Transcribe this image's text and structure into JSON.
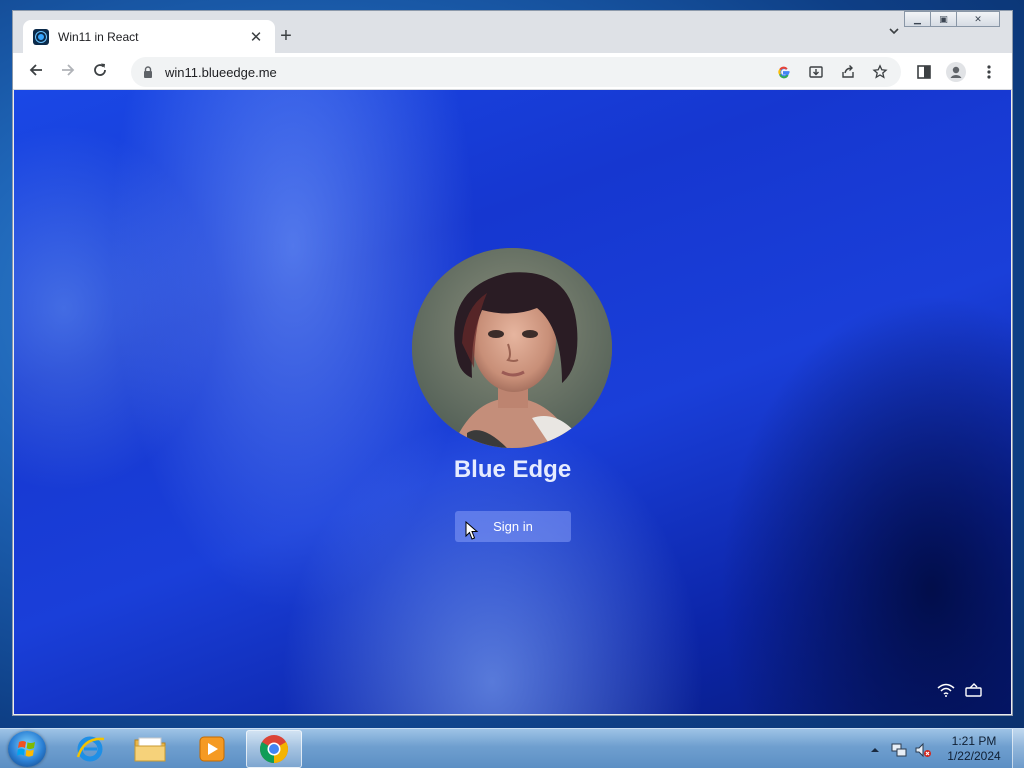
{
  "browser": {
    "tab": {
      "title": "Win11 in React",
      "favicon_icon": "win11-react-favicon",
      "close_icon": "close-icon"
    },
    "new_tab_icon": "plus-icon",
    "tab_search_icon": "chevron-down-icon",
    "window_controls": [
      "minimize-icon",
      "restore-icon",
      "close-icon"
    ],
    "toolbar": {
      "back_icon": "arrow-left-icon",
      "forward_icon": "arrow-right-icon",
      "reload_icon": "reload-icon",
      "lock_icon": "lock-icon",
      "url": "win11.blueedge.me",
      "omnibox_icons": [
        "google-icon",
        "install-app-icon",
        "share-icon",
        "bookmark-star-icon"
      ],
      "side_panel_icon": "side-panel-icon",
      "profile_icon": "profile-avatar-icon",
      "menu_icon": "kebab-menu-icon"
    }
  },
  "lockscreen": {
    "user_name": "Blue Edge",
    "sign_in_label": "Sign in",
    "status_icons": [
      "wifi-icon",
      "battery-icon"
    ]
  },
  "taskbar": {
    "start_icon": "windows-start-icon",
    "apps": [
      {
        "name": "internet-explorer-icon",
        "active": false
      },
      {
        "name": "file-explorer-icon",
        "active": false
      },
      {
        "name": "media-player-icon",
        "active": false
      },
      {
        "name": "chrome-icon",
        "active": true
      }
    ],
    "tray_icons": [
      "show-hidden-icons-arrow",
      "network-icon",
      "volume-muted-icon"
    ],
    "time": "1:21 PM",
    "date": "1/22/2024"
  },
  "colors": {
    "desktop_blue": "#1f66b8",
    "lockscreen_blue": "#1a3fd9",
    "chrome_tabstrip": "#dee1e6",
    "omnibox_bg": "#f1f3f4"
  }
}
